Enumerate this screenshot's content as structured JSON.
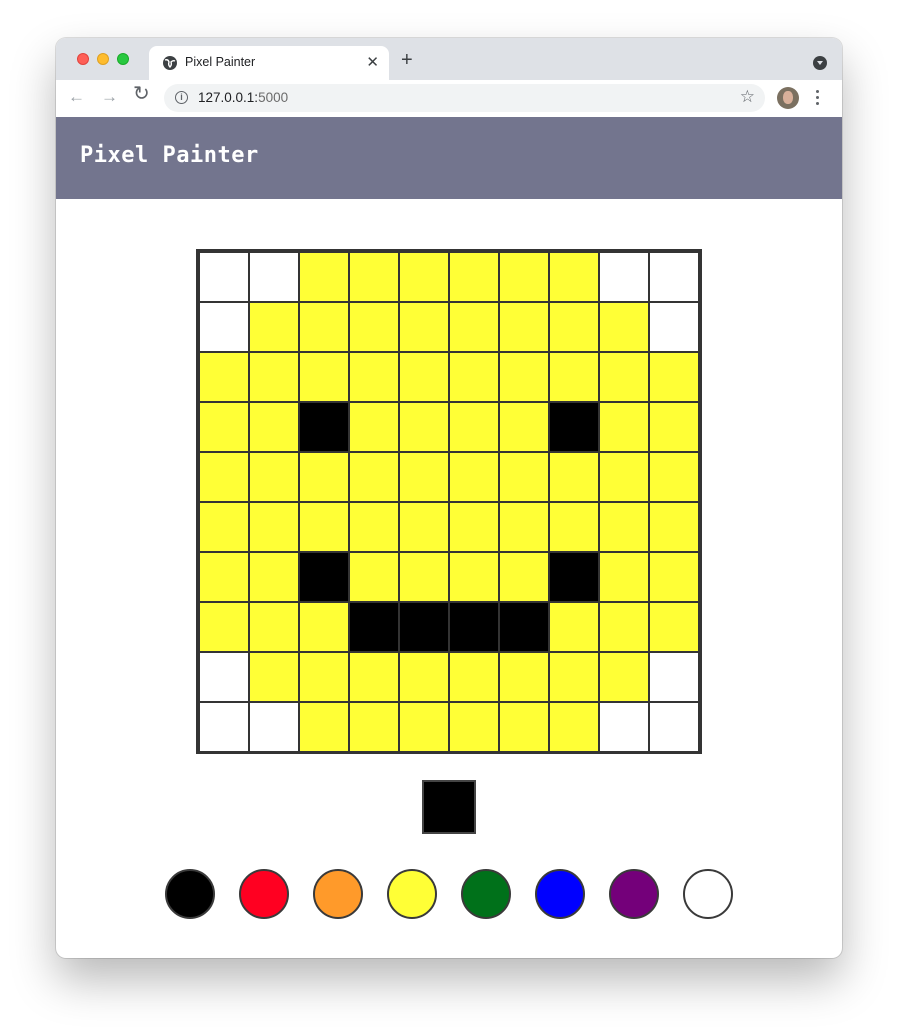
{
  "browser": {
    "tab_title": "Pixel Painter",
    "url_host": "127.0.0.1:",
    "url_port": "5000",
    "new_tab_label": "+",
    "tab_close_label": "✕"
  },
  "app": {
    "title": "Pixel Painter"
  },
  "palette": {
    "black": "#000000",
    "red": "#ff0021",
    "orange": "#ff9a2a",
    "yellow": "#ffff36",
    "green": "#00711a",
    "blue": "#0000ff",
    "purple": "#74007a",
    "white": "#ffffff"
  },
  "swatches": [
    "black",
    "red",
    "orange",
    "yellow",
    "green",
    "blue",
    "purple",
    "white"
  ],
  "current_color": "black",
  "grid": {
    "rows": 10,
    "cols": 10,
    "cells": [
      "WWYYYYYYWW",
      "WYYYYYYYYW",
      "YYYYYYYYYY",
      "YYKYYYYKYY",
      "YYYYYYYYYY",
      "YYYYYYYYYY",
      "YYKYYYYKYY",
      "YYYKKKKYYY",
      "WYYYYYYYYW",
      "WWYYYYYYWW"
    ],
    "legend": {
      "W": "white",
      "Y": "yellow",
      "K": "black"
    }
  }
}
